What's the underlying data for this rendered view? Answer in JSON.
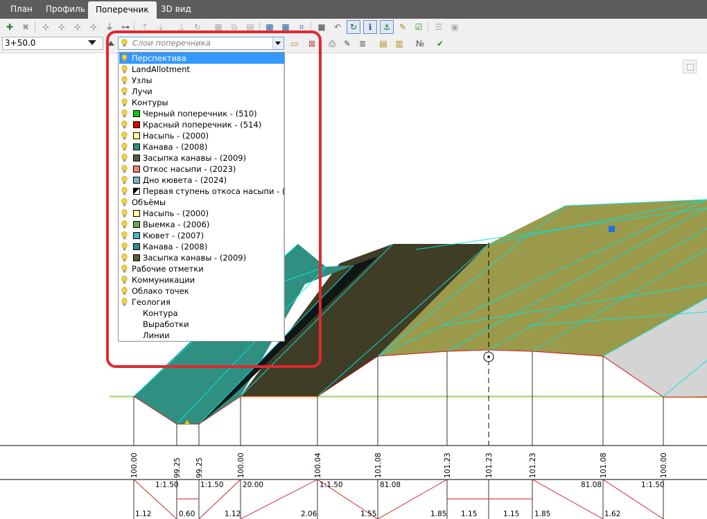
{
  "tabs": [
    {
      "label": "План",
      "active": false
    },
    {
      "label": "Профиль",
      "active": false
    },
    {
      "label": "Поперечник",
      "active": true
    },
    {
      "label": "3D вид",
      "active": false
    }
  ],
  "station": {
    "value": "3+50.0"
  },
  "layer_selector": {
    "placeholder": "Слои поперечника"
  },
  "layers": [
    {
      "label": "Перспектива",
      "selected": true,
      "indent": 0
    },
    {
      "label": "LandAllotment",
      "indent": 0
    },
    {
      "label": "Узлы",
      "indent": 0
    },
    {
      "label": "Лучи",
      "indent": 0
    },
    {
      "label": "Контуры",
      "indent": 0
    },
    {
      "label": "Черный поперечник - (510)",
      "indent": 1,
      "swatch": "#00cc00"
    },
    {
      "label": "Красный поперечник - (514)",
      "indent": 1,
      "swatch": "#dd0000"
    },
    {
      "label": "Насыпь - (2000)",
      "indent": 1,
      "swatch": "#ffff99"
    },
    {
      "label": "Канава - (2008)",
      "indent": 1,
      "swatch": "#2f8f80"
    },
    {
      "label": "Засыпка канавы - (2009)",
      "indent": 1,
      "swatch": "#5f5a3a"
    },
    {
      "label": "Откос насыпи - (2023)",
      "indent": 1,
      "swatch": "#f08080"
    },
    {
      "label": "Дно кювета - (2024)",
      "indent": 1,
      "swatch": "#7fb5c8"
    },
    {
      "label": "Первая ступень откоса насыпи - (2",
      "indent": 1,
      "swatch": "diag"
    },
    {
      "label": "Объёмы",
      "indent": 0
    },
    {
      "label": "Насыпь - (2000)",
      "indent": 1,
      "swatch": "#ffff99"
    },
    {
      "label": "Выемка - (2006)",
      "indent": 1,
      "swatch": "#6aa84f"
    },
    {
      "label": "Кювет - (2007)",
      "indent": 1,
      "swatch": "#3fb8c8"
    },
    {
      "label": "Канава - (2008)",
      "indent": 1,
      "swatch": "#2f8f80"
    },
    {
      "label": "Засыпка канавы - (2009)",
      "indent": 1,
      "swatch": "#5f5a3a"
    },
    {
      "label": "Рабочие отметки",
      "indent": 0
    },
    {
      "label": "Коммуникации",
      "indent": 0
    },
    {
      "label": "Облако точек",
      "indent": 0
    },
    {
      "label": "Геология",
      "indent": 0
    },
    {
      "label": "Контура",
      "indent": 1,
      "nobulb": true
    },
    {
      "label": "Выработки",
      "indent": 1,
      "nobulb": true
    },
    {
      "label": "Линии",
      "indent": 1,
      "nobulb": true
    }
  ],
  "elevations": [
    "100.00",
    "99.25",
    "99.25",
    "100.00",
    "100.04",
    "101.08",
    "101.23",
    "101.23",
    "101.23",
    "101.08",
    "100.00"
  ],
  "slope_labels": [
    "1:1.50",
    "1:1.50",
    "20.00",
    "1:1.50",
    "81.08",
    "81.08",
    "1:1.50"
  ],
  "distance_labels": [
    "1.12",
    "0.60",
    "1.12",
    "2.06",
    "1.55",
    "1.85",
    "1.15",
    "1.15",
    "1.85",
    "1.62"
  ],
  "colors": {
    "tab_bar": "#5d5d5d",
    "teal": "#2f8f80",
    "dark_fill": "#3f3d25",
    "olive_fill": "#9b9a4a",
    "cyan_line": "#00e5e5",
    "red_line": "#d01818",
    "highlight": "#e0282f"
  }
}
